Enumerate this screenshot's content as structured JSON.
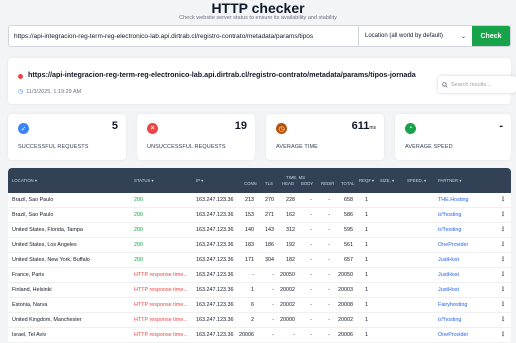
{
  "header": {
    "title": "HTTP checker",
    "subtitle": "Check website server status to ensure its availability and stability"
  },
  "search": {
    "url_value": "https://api-integracion-reg-term-reg-electronico-lab.api.dirtrab.cl/registro-contrato/metadata/params/tipos",
    "location": "Location (all world by default)",
    "check_label": "Check"
  },
  "result": {
    "url": "https://api-integracion-reg-term-reg-electronico-lab.api.dirtrab.cl/registro-contrato/metadata/params/tipos-jornada",
    "checked_at": "11/3/2025, 1:19:29 AM",
    "status_color": "#ef4444",
    "search_results_placeholder": "Search results..."
  },
  "stats": [
    {
      "label": "SUCCESSFUL REQUESTS",
      "value": "5",
      "unit": "",
      "icon": "check-circle-icon",
      "color": "#3b82f6"
    },
    {
      "label": "UNSUCCESSFUL REQUESTS",
      "value": "19",
      "unit": "",
      "icon": "x-circle-icon",
      "color": "#ef4444"
    },
    {
      "label": "AVERAGE TIME",
      "value": "611",
      "unit": "ms",
      "icon": "clock-icon",
      "color": "#d97706"
    },
    {
      "label": "AVERAGE SPEED",
      "value": "-",
      "unit": "",
      "icon": "speedometer-icon",
      "color": "#16a34a"
    }
  ],
  "table": {
    "headers": {
      "location": "LOCATION ▾",
      "status": "STATUS ▾",
      "ip": "IP ▾",
      "conn": "CONN",
      "tls": "TLS",
      "timeline_top": "TIME, MS",
      "head": "HEAD",
      "body": "BODY",
      "redir": "REDIR",
      "total": "TOTAL",
      "reqs": "REQ# ▾",
      "size": "SIZE, ▾",
      "speed": "SPEED, ▾",
      "partner": "PARTNER ▾"
    },
    "rows": [
      {
        "location": "Brazil, Sao Paulo",
        "status": "200",
        "ok": true,
        "ip": "163.247.123.36",
        "conn": "213",
        "tls": "270",
        "head": "228",
        "body": "-",
        "redir": "-",
        "total": "658",
        "reqs": "1",
        "partner": "THE.Hosting"
      },
      {
        "location": "Brazil, Sao Paulo",
        "status": "200",
        "ok": true,
        "ip": "163.247.123.36",
        "conn": "153",
        "tls": "271",
        "head": "162",
        "body": "-",
        "redir": "-",
        "total": "586",
        "reqs": "1",
        "partner": "is*hosting"
      },
      {
        "location": "United States, Florida, Tampa",
        "status": "200",
        "ok": true,
        "ip": "163.247.123.36",
        "conn": "140",
        "tls": "143",
        "head": "312",
        "body": "-",
        "redir": "-",
        "total": "595",
        "reqs": "1",
        "partner": "is*hosting"
      },
      {
        "location": "United States, Los Angeles",
        "status": "200",
        "ok": true,
        "ip": "163.247.123.36",
        "conn": "183",
        "tls": "186",
        "head": "192",
        "body": "-",
        "redir": "-",
        "total": "561",
        "reqs": "1",
        "partner": "OneProvider"
      },
      {
        "location": "United States, New York, Buffalo",
        "status": "200",
        "ok": true,
        "ip": "163.247.123.36",
        "conn": "171",
        "tls": "304",
        "head": "182",
        "body": "-",
        "redir": "-",
        "total": "657",
        "reqs": "1",
        "partner": "JustHost"
      },
      {
        "location": "France, Paris",
        "status": "HTTP response time...",
        "ok": false,
        "ip": "163.247.123.36",
        "conn": "-",
        "tls": "-",
        "head": "20050",
        "body": "-",
        "redir": "-",
        "total": "20050",
        "reqs": "1",
        "partner": "JustHost"
      },
      {
        "location": "Finland, Helsinki",
        "status": "HTTP response time...",
        "ok": false,
        "ip": "163.247.123.36",
        "conn": "1",
        "tls": "-",
        "head": "20002",
        "body": "-",
        "redir": "-",
        "total": "20003",
        "reqs": "1",
        "partner": "JustHost"
      },
      {
        "location": "Estonia, Narva",
        "status": "HTTP response time...",
        "ok": false,
        "ip": "163.247.123.36",
        "conn": "6",
        "tls": "-",
        "head": "20002",
        "body": "-",
        "redir": "-",
        "total": "20008",
        "reqs": "1",
        "partner": "Fairyhosting"
      },
      {
        "location": "United Kingdom, Manchester",
        "status": "HTTP response time...",
        "ok": false,
        "ip": "163.247.123.36",
        "conn": "2",
        "tls": "-",
        "head": "20000",
        "body": "-",
        "redir": "-",
        "total": "20002",
        "reqs": "1",
        "partner": "is*hosting"
      },
      {
        "location": "Israel, Tel Aviv",
        "status": "HTTP response time...",
        "ok": false,
        "ip": "163.247.123.36",
        "conn": "20006",
        "tls": "-",
        "head": "-",
        "body": "-",
        "redir": "-",
        "total": "20006",
        "reqs": "1",
        "partner": "OneProvider"
      }
    ]
  }
}
